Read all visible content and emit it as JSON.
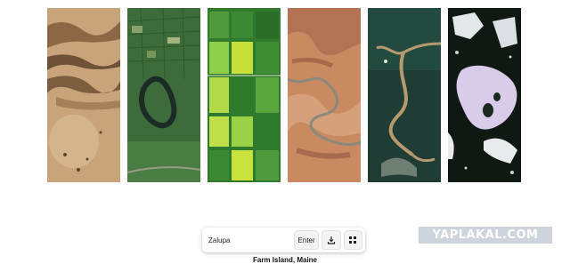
{
  "gallery": {
    "images": [
      {
        "name": "arid-ridges-image"
      },
      {
        "name": "oxbow-river-farmland-image"
      },
      {
        "name": "green-field-grid-image"
      },
      {
        "name": "canyon-river-image"
      },
      {
        "name": "delta-river-image"
      },
      {
        "name": "snow-forest-image"
      }
    ]
  },
  "search": {
    "value": "Zalupa",
    "placeholder": "",
    "enter_label": "Enter",
    "download_icon": "download-icon",
    "grid_icon": "grid-icon"
  },
  "caption": {
    "place": "Farm Island, Maine"
  },
  "watermark": {
    "text": "YAPLAKAL.COM"
  },
  "colors": {
    "accent": "#222222",
    "watermark_bg": "#bec6d2"
  }
}
